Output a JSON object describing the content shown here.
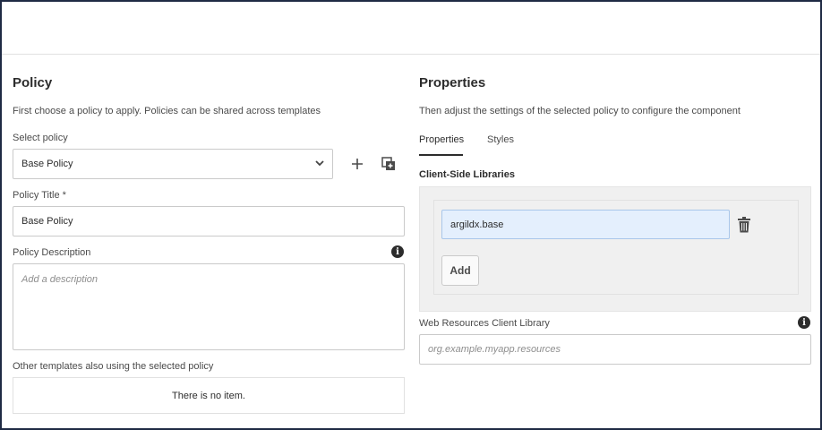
{
  "policy": {
    "heading": "Policy",
    "subtitle": "First choose a policy to apply. Policies can be shared across templates",
    "select_label": "Select policy",
    "select_value": "Base Policy",
    "title_label": "Policy Title *",
    "title_value": "Base Policy",
    "description_label": "Policy Description",
    "description_placeholder": "Add a description",
    "other_templates_label": "Other templates also using the selected policy",
    "no_item_text": "There is no item."
  },
  "properties": {
    "heading": "Properties",
    "subtitle": "Then adjust the settings of the selected policy to configure the component",
    "tabs": [
      {
        "label": "Properties",
        "active": true
      },
      {
        "label": "Styles",
        "active": false
      }
    ],
    "client_libs_title": "Client-Side Libraries",
    "client_libs": [
      {
        "value": "argildx.base"
      }
    ],
    "add_label": "Add",
    "web_resources_label": "Web Resources Client Library",
    "web_resources_placeholder": "org.example.myapp.resources"
  },
  "icons": {
    "dropdown": "chevron-down-icon",
    "add": "plus-icon",
    "copy": "duplicate-icon",
    "info": "info-icon",
    "delete": "trash-icon"
  }
}
